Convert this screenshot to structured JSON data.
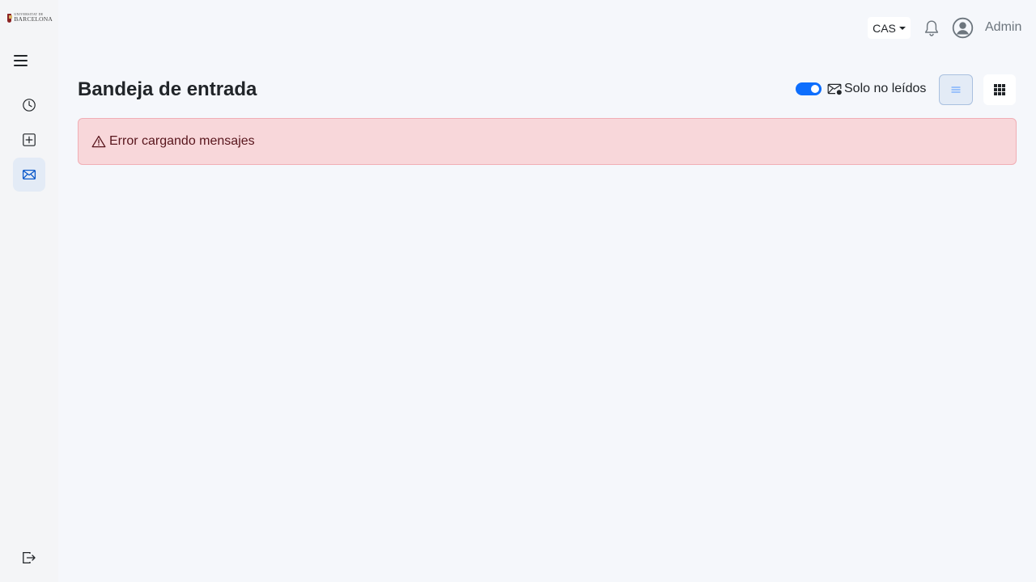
{
  "app": {
    "logo": {
      "line1": "UNIVERSITAT DE",
      "line2": "BARCELONA"
    }
  },
  "sidebar": {
    "items": [
      {
        "name": "history",
        "icon": "clock-icon",
        "active": false
      },
      {
        "name": "new",
        "icon": "plus-square-icon",
        "active": false
      },
      {
        "name": "inbox",
        "icon": "envelope-icon",
        "active": true
      }
    ],
    "logout_icon": "logout-icon"
  },
  "header": {
    "language": "CAS",
    "user": "Admin"
  },
  "main": {
    "title": "Bandeja de entrada",
    "filter": {
      "label": "Solo no leídos",
      "enabled": true
    },
    "views": {
      "list_active": true,
      "grid_active": false
    },
    "alert": {
      "message": "Error cargando mensajes"
    }
  },
  "colors": {
    "accent": "#0d6efd",
    "alert_bg": "#f8d7da",
    "alert_text": "#58151c",
    "active_nav": "#e3ebf6"
  }
}
